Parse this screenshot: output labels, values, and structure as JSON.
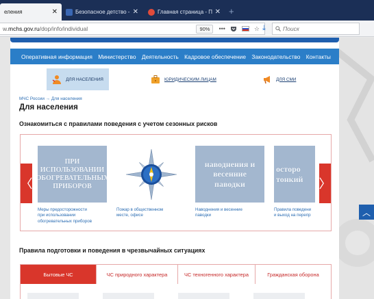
{
  "browser": {
    "tabs": [
      {
        "title": "еления",
        "active": true,
        "favicon_color": "#f2f3f5"
      },
      {
        "title": "Безопасное детство - закон",
        "active": false,
        "favicon_color": "#3a67b3"
      },
      {
        "title": "Главная страница - Портал д",
        "active": false,
        "favicon_color": "#e04b3b"
      }
    ],
    "new_tab": "+",
    "close_glyph": "✕",
    "url_prefix": "w.",
    "url_domain": "mchs.gov.ru",
    "url_path": "/dop/info/individual",
    "zoom": "90%",
    "search_placeholder": "Поиск"
  },
  "site": {
    "nav": [
      "Оперативная информация",
      "Министерство",
      "Деятельность",
      "Кадровое обеспечение",
      "Законодательство",
      "Контакты"
    ],
    "audiences": [
      "ДЛЯ НАСЕЛЕНИЯ",
      "ЮРИДИЧЕСКИМ ЛИЦАМ",
      "ДЛЯ СМИ"
    ],
    "breadcrumb_home": "МЧС России",
    "breadcrumb_sep": "→",
    "breadcrumb_current": "Для населения",
    "page_title": "Для населения",
    "section1_title": "Ознакомиться с правилами поведения с учетом сезонных рисков",
    "carousel": {
      "prev": "〈",
      "next": "〉",
      "cards": [
        {
          "image_text": "ПРИ\nИСПОЛЬЗОВАНИИ\nОБОГРЕВАТЕЛЬНЫХ\nПРИБОРОВ",
          "caption": "Меры предосторожности\nпри использовании\nобогревательных приборов"
        },
        {
          "image_text": "",
          "caption": "Пожар в общественном\nместе, офисе"
        },
        {
          "image_text": "наводнения и\nвесенние\nпаводки",
          "caption": "Наводнения и весенние\nпаводки"
        },
        {
          "image_text": "осторо\nтонкий",
          "caption": "Правила поведени\nи выход на перепр"
        }
      ]
    },
    "section2_title": "Правила подготовки и поведения в чрезвычайных ситуациях",
    "es_tabs": [
      {
        "label": "Бытовые ЧС",
        "active": true
      },
      {
        "label": "ЧС природного характера",
        "active": false
      },
      {
        "label": "ЧС техногенного характера",
        "active": false
      },
      {
        "label": "Гражданская оборона",
        "active": false
      }
    ],
    "scroll_top": "︿"
  },
  "colors": {
    "nav_blue": "#2b7ec8",
    "accent_red": "#d9362b",
    "link_blue": "#2b6db3",
    "thumb_blue": "#a3b7cf"
  }
}
